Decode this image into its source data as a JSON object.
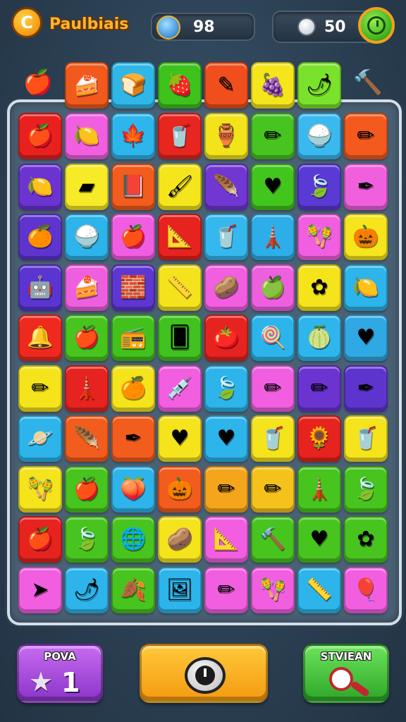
{
  "header": {
    "title": "Paulbiais",
    "hints_value": "98",
    "coins_value": "50",
    "logo_icon": "c-logo-icon",
    "hints_icon": "feather-icon",
    "coins_icon": "coin-icon",
    "timer_icon": "clock-icon"
  },
  "top_row": {
    "left": "apple-icon",
    "right": "hammer-icon",
    "tiles": [
      {
        "icon": "cake-icon",
        "glyph": "🍰",
        "color": "#f15a1c"
      },
      {
        "icon": "bread-icon",
        "glyph": "🍞",
        "color": "#2fb7e8"
      },
      {
        "icon": "berry-icon",
        "glyph": "🍓",
        "color": "#3ec21c"
      },
      {
        "icon": "pencil-icon",
        "glyph": "✎",
        "color": "#f04e1c"
      },
      {
        "icon": "grape-icon",
        "glyph": "🍇",
        "color": "#f5e51b"
      },
      {
        "icon": "chili-icon",
        "glyph": "🌶",
        "color": "#7be22c"
      }
    ]
  },
  "board": {
    "rows": [
      [
        {
          "icon": "apple-icon",
          "glyph": "🍎",
          "color": "#e8201e"
        },
        {
          "icon": "lemon-icon",
          "glyph": "🍋",
          "color": "#f15fe0"
        },
        {
          "icon": "leaf-icon",
          "glyph": "🍁",
          "color": "#2db6ec"
        },
        {
          "icon": "cup-icon",
          "glyph": "🥤",
          "color": "#e6261f"
        },
        {
          "icon": "jar-icon",
          "glyph": "🏺",
          "color": "#f3e31b"
        },
        {
          "icon": "pencil-icon",
          "glyph": "✏",
          "color": "#47c41f"
        },
        {
          "icon": "bowl-icon",
          "glyph": "🍚",
          "color": "#3ab9ef"
        },
        {
          "icon": "pencil-icon",
          "glyph": "✏",
          "color": "#f45a1d"
        }
      ],
      [
        {
          "icon": "lemon-icon",
          "glyph": "🍋",
          "color": "#6b34d1"
        },
        {
          "icon": "eraser-icon",
          "glyph": "▰",
          "color": "#f7ea27"
        },
        {
          "icon": "book-icon",
          "glyph": "📕",
          "color": "#f25c1c"
        },
        {
          "icon": "brush-icon",
          "glyph": "🖌",
          "color": "#f5e51d"
        },
        {
          "icon": "feather-icon",
          "glyph": "🪶",
          "color": "#7137d2"
        },
        {
          "icon": "heart-icon",
          "glyph": "♥",
          "color": "#42c51d"
        },
        {
          "icon": "leaf-icon",
          "glyph": "🍃",
          "color": "#5a3ad4"
        },
        {
          "icon": "pen-icon",
          "glyph": "✒",
          "color": "#f060dd"
        }
      ],
      [
        {
          "icon": "orange-icon",
          "glyph": "🍊",
          "color": "#5e34cf"
        },
        {
          "icon": "bowl-icon",
          "glyph": "🍚",
          "color": "#2db4ea"
        },
        {
          "icon": "apple-icon",
          "glyph": "🍎",
          "color": "#f15de0"
        },
        {
          "icon": "ruler-icon",
          "glyph": "📐",
          "color": "#e6231e"
        },
        {
          "icon": "cup-icon",
          "glyph": "🥤",
          "color": "#35b8ee"
        },
        {
          "icon": "tower-icon",
          "glyph": "🗼",
          "color": "#2eaee9"
        },
        {
          "icon": "rattle-icon",
          "glyph": "🪇",
          "color": "#f15fe0"
        },
        {
          "icon": "pumpkin-icon",
          "glyph": "🎃",
          "color": "#f6e41d"
        }
      ],
      [
        {
          "icon": "robot-icon",
          "glyph": "🤖",
          "color": "#5a35d2"
        },
        {
          "icon": "cake-icon",
          "glyph": "🍰",
          "color": "#ee5fdf"
        },
        {
          "icon": "block-icon",
          "glyph": "🧱",
          "color": "#5e36d2"
        },
        {
          "icon": "ruler-icon",
          "glyph": "📏",
          "color": "#f4e31c"
        },
        {
          "icon": "potato-icon",
          "glyph": "🥔",
          "color": "#f15fe0"
        },
        {
          "icon": "apple-icon",
          "glyph": "🍏",
          "color": "#ee5fdf"
        },
        {
          "icon": "flower-icon",
          "glyph": "✿",
          "color": "#f5e31c"
        },
        {
          "icon": "lemon-icon",
          "glyph": "🍋",
          "color": "#2db4ea"
        }
      ],
      [
        {
          "icon": "bell-icon",
          "glyph": "🔔",
          "color": "#ee2a1f"
        },
        {
          "icon": "apple-icon",
          "glyph": "🍎",
          "color": "#47c41e"
        },
        {
          "icon": "radio-icon",
          "glyph": "📻",
          "color": "#42c11d"
        },
        {
          "icon": "card-icon",
          "glyph": "🂠",
          "color": "#41c21e"
        },
        {
          "icon": "tomato-icon",
          "glyph": "🍅",
          "color": "#e6231e"
        },
        {
          "icon": "candy-icon",
          "glyph": "🍭",
          "color": "#2db4ea"
        },
        {
          "icon": "melon-icon",
          "glyph": "🍈",
          "color": "#2eb6ec"
        },
        {
          "icon": "heart-icon",
          "glyph": "♥",
          "color": "#2fa8e4"
        }
      ],
      [
        {
          "icon": "pencil-icon",
          "glyph": "✏",
          "color": "#f5e31c"
        },
        {
          "icon": "tower-icon",
          "glyph": "🗼",
          "color": "#e6231e"
        },
        {
          "icon": "orange-icon",
          "glyph": "🍊",
          "color": "#f5e31c"
        },
        {
          "icon": "syringe-icon",
          "glyph": "💉",
          "color": "#f15fe0"
        },
        {
          "icon": "leaf-icon",
          "glyph": "🍃",
          "color": "#2db4ea"
        },
        {
          "icon": "pencil-icon",
          "glyph": "✏",
          "color": "#f15fe0"
        },
        {
          "icon": "pencil-icon",
          "glyph": "✏",
          "color": "#6b34d1"
        },
        {
          "icon": "pen-icon",
          "glyph": "✒",
          "color": "#5e34cf"
        }
      ],
      [
        {
          "icon": "planet-icon",
          "glyph": "🪐",
          "color": "#2db4ea"
        },
        {
          "icon": "feather-icon",
          "glyph": "🪶",
          "color": "#f25c1c"
        },
        {
          "icon": "pen-icon",
          "glyph": "✒",
          "color": "#f25c1c"
        },
        {
          "icon": "heart-icon",
          "glyph": "♥",
          "color": "#f5e31c"
        },
        {
          "icon": "heart-icon",
          "glyph": "♥",
          "color": "#2db4ea"
        },
        {
          "icon": "cup-icon",
          "glyph": "🥤",
          "color": "#f5e31c"
        },
        {
          "icon": "flower-icon",
          "glyph": "🌻",
          "color": "#e6231e"
        },
        {
          "icon": "cup-icon",
          "glyph": "🥤",
          "color": "#f5e31c"
        }
      ],
      [
        {
          "icon": "rattle-icon",
          "glyph": "🪇",
          "color": "#f5e31c"
        },
        {
          "icon": "apple-icon",
          "glyph": "🍎",
          "color": "#47c41e"
        },
        {
          "icon": "plum-icon",
          "glyph": "🍑",
          "color": "#2db4ea"
        },
        {
          "icon": "pumpkin-icon",
          "glyph": "🎃",
          "color": "#f25c1c"
        },
        {
          "icon": "pencil-icon",
          "glyph": "✏",
          "color": "#f5a51c"
        },
        {
          "icon": "pencil-icon",
          "glyph": "✏",
          "color": "#f5c21c"
        },
        {
          "icon": "tower-icon",
          "glyph": "🗼",
          "color": "#47c41e"
        },
        {
          "icon": "leaf-icon",
          "glyph": "🍃",
          "color": "#47c41e"
        }
      ],
      [
        {
          "icon": "apple-icon",
          "glyph": "🍎",
          "color": "#e6231e"
        },
        {
          "icon": "leaf-icon",
          "glyph": "🍃",
          "color": "#47c41e"
        },
        {
          "icon": "globe-icon",
          "glyph": "🌐",
          "color": "#47c41e"
        },
        {
          "icon": "potato-icon",
          "glyph": "🥔",
          "color": "#f5e31c"
        },
        {
          "icon": "ruler-icon",
          "glyph": "📐",
          "color": "#f15fe0"
        },
        {
          "icon": "hammer-icon",
          "glyph": "🔨",
          "color": "#47c41e"
        },
        {
          "icon": "heart-icon",
          "glyph": "♥",
          "color": "#47c41e"
        },
        {
          "icon": "flower-icon",
          "glyph": "✿",
          "color": "#47c41e"
        }
      ],
      [
        {
          "icon": "cursor-icon",
          "glyph": "➤",
          "color": "#f15fe0"
        },
        {
          "icon": "chili-icon",
          "glyph": "🌶",
          "color": "#2db4ea"
        },
        {
          "icon": "leaf-icon",
          "glyph": "🍂",
          "color": "#47c41e"
        },
        {
          "icon": "frame-icon",
          "glyph": "🖼",
          "color": "#2db4ea"
        },
        {
          "icon": "pencil-icon",
          "glyph": "✏",
          "color": "#f15fe0"
        },
        {
          "icon": "rattle-icon",
          "glyph": "🪇",
          "color": "#f15fe0"
        },
        {
          "icon": "ruler-icon",
          "glyph": "📏",
          "color": "#2db4ea"
        },
        {
          "icon": "balloon-icon",
          "glyph": "🎈",
          "color": "#f15fe0"
        }
      ]
    ]
  },
  "footer": {
    "left_label": "POVA",
    "left_count": "1",
    "left_icon": "star-icon",
    "mid_icon": "shuffle-icon",
    "right_label": "STVIEAN",
    "right_icon": "magnifier-icon"
  }
}
